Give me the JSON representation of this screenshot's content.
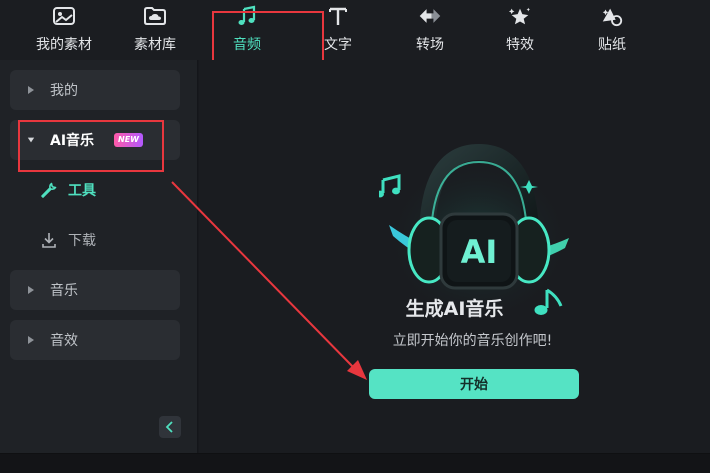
{
  "toolbar": {
    "tabs": [
      {
        "label": "我的素材",
        "icon": "image-folder-icon"
      },
      {
        "label": "素材库",
        "icon": "cloud-folder-icon"
      },
      {
        "label": "音频",
        "icon": "music-note-icon",
        "active": true
      },
      {
        "label": "文字",
        "icon": "text-t-icon"
      },
      {
        "label": "转场",
        "icon": "transition-arrows-icon"
      },
      {
        "label": "特效",
        "icon": "sparkle-star-icon"
      },
      {
        "label": "贴纸",
        "icon": "sticker-icon"
      }
    ]
  },
  "sidebar": {
    "items": [
      {
        "label": "我的"
      },
      {
        "label": "AI音乐",
        "badge": "NEW",
        "expanded": true
      },
      {
        "label": "音乐"
      },
      {
        "label": "音效"
      }
    ],
    "subitems": [
      {
        "label": "工具",
        "icon": "wrench-icon",
        "active": true
      },
      {
        "label": "下载",
        "icon": "download-icon"
      }
    ]
  },
  "main": {
    "title": "生成AI音乐",
    "subtitle": "立即开始你的音乐创作吧!",
    "start_label": "开始",
    "hero_text": "AI"
  },
  "colors": {
    "accent": "#55e3c4",
    "highlight": "#e8373e",
    "badge_from": "#ff5aa8",
    "badge_to": "#b259ff"
  }
}
